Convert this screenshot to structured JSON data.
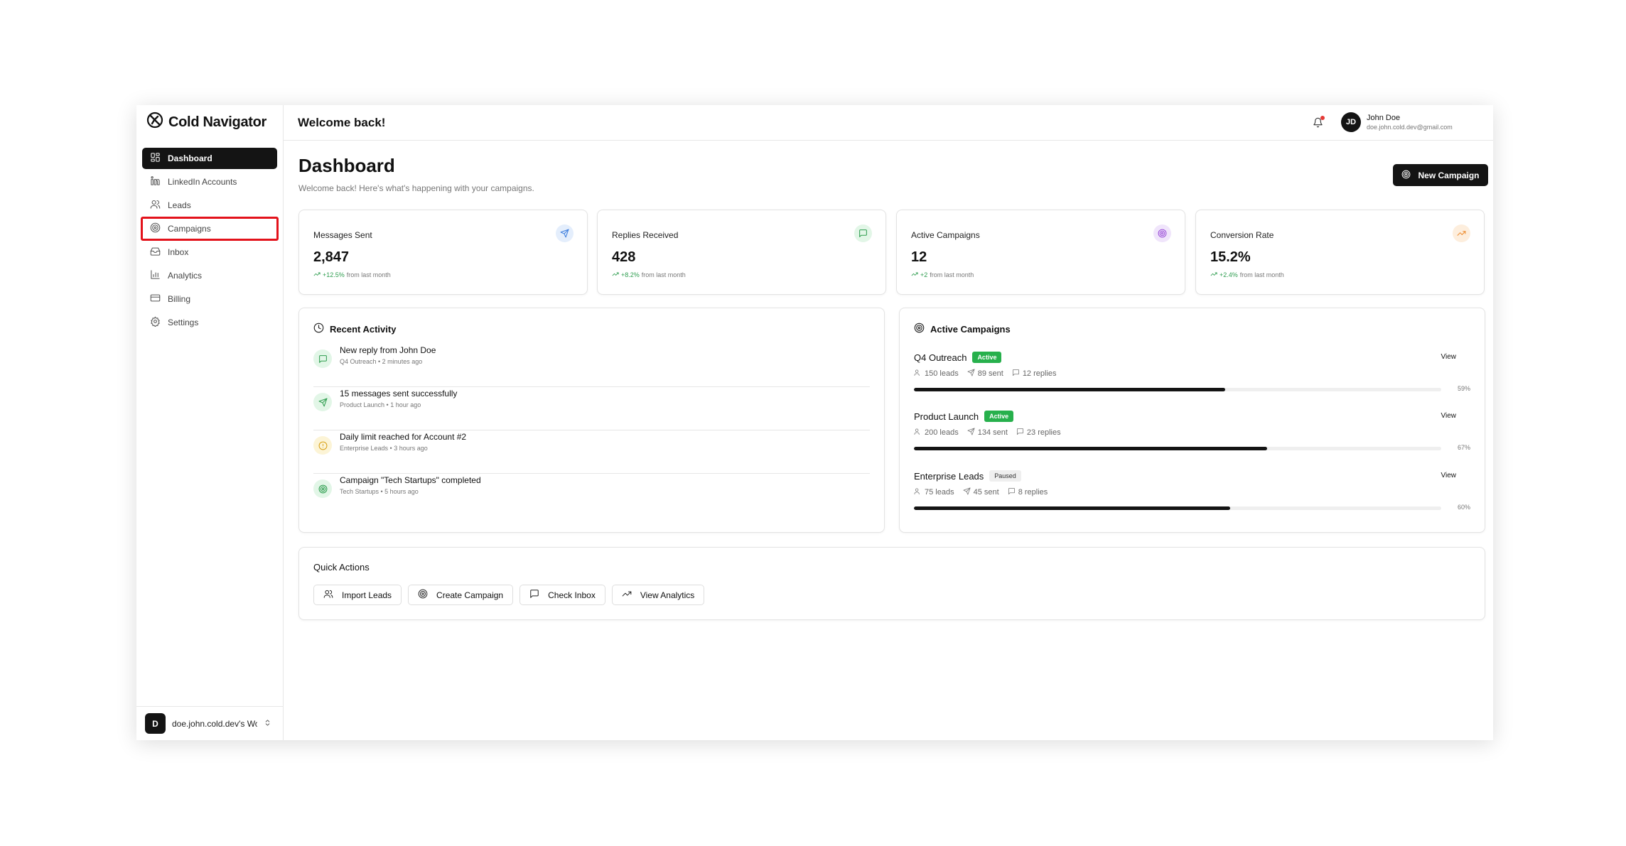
{
  "brand": {
    "name": "Cold Navigator"
  },
  "sidebar": {
    "items": [
      {
        "label": "Dashboard",
        "icon": "dashboard-grid-icon",
        "active": true
      },
      {
        "label": "LinkedIn Accounts",
        "icon": "linkedin-icon"
      },
      {
        "label": "Leads",
        "icon": "users-icon"
      },
      {
        "label": "Campaigns",
        "icon": "target-icon",
        "highlighted": true
      },
      {
        "label": "Inbox",
        "icon": "inbox-icon"
      },
      {
        "label": "Analytics",
        "icon": "bar-chart-icon"
      },
      {
        "label": "Billing",
        "icon": "credit-card-icon"
      },
      {
        "label": "Settings",
        "icon": "gear-icon"
      }
    ],
    "workspace": {
      "initial": "D",
      "name": "doe.john.cold.dev's Workspace"
    }
  },
  "header": {
    "title": "Welcome back!",
    "user": {
      "initials": "JD",
      "name": "John Doe",
      "email": "doe.john.cold.dev@gmail.com"
    }
  },
  "page": {
    "title": "Dashboard",
    "subtitle": "Welcome back! Here's what's happening with your campaigns.",
    "new_campaign_label": "New Campaign"
  },
  "stats": [
    {
      "label": "Messages Sent",
      "value": "2,847",
      "change": "+12.5%",
      "suffix": "from last month",
      "icon": "send-icon",
      "icon_color": "#3b7ddd",
      "icon_bg": "#e4eefc"
    },
    {
      "label": "Replies Received",
      "value": "428",
      "change": "+8.2%",
      "suffix": "from last month",
      "icon": "message-icon",
      "icon_color": "#2e9d4f",
      "icon_bg": "#e2f6e7"
    },
    {
      "label": "Active Campaigns",
      "value": "12",
      "change": "+2",
      "suffix": "from last month",
      "icon": "target-icon",
      "icon_color": "#9b4fd8",
      "icon_bg": "#f0e5fb"
    },
    {
      "label": "Conversion Rate",
      "value": "15.2%",
      "change": "+2.4%",
      "suffix": "from last month",
      "icon": "trending-up-icon",
      "icon_color": "#ec8a2c",
      "icon_bg": "#fdeedd"
    }
  ],
  "recent_activity": {
    "title": "Recent Activity",
    "items": [
      {
        "title": "New reply from John Doe",
        "meta": "Q4 Outreach • 2 minutes ago",
        "icon": "message-icon",
        "icon_color": "#2e9d4f",
        "icon_bg": "#e2f6e7"
      },
      {
        "title": "15 messages sent successfully",
        "meta": "Product Launch • 1 hour ago",
        "icon": "send-icon",
        "icon_color": "#2e9d4f",
        "icon_bg": "#e2f6e7"
      },
      {
        "title": "Daily limit reached for Account #2",
        "meta": "Enterprise Leads • 3 hours ago",
        "icon": "alert-circle-icon",
        "icon_color": "#d8a015",
        "icon_bg": "#fcf4d6"
      },
      {
        "title": "Campaign \"Tech Startups\" completed",
        "meta": "Tech Startups • 5 hours ago",
        "icon": "target-icon",
        "icon_color": "#2e9d4f",
        "icon_bg": "#e2f6e7"
      }
    ]
  },
  "active_campaigns": {
    "title": "Active Campaigns",
    "view_label": "View",
    "items": [
      {
        "name": "Q4 Outreach",
        "status": "Active",
        "leads": "150 leads",
        "sent": "89 sent",
        "replies": "12 replies",
        "progress": 59,
        "progress_label": "59%"
      },
      {
        "name": "Product Launch",
        "status": "Active",
        "leads": "200 leads",
        "sent": "134 sent",
        "replies": "23 replies",
        "progress": 67,
        "progress_label": "67%"
      },
      {
        "name": "Enterprise Leads",
        "status": "Paused",
        "leads": "75 leads",
        "sent": "45 sent",
        "replies": "8 replies",
        "progress": 60,
        "progress_label": "60%"
      }
    ]
  },
  "quick_actions": {
    "title": "Quick Actions",
    "items": [
      {
        "label": "Import Leads",
        "icon": "users-icon"
      },
      {
        "label": "Create Campaign",
        "icon": "target-icon"
      },
      {
        "label": "Check Inbox",
        "icon": "message-icon"
      },
      {
        "label": "View Analytics",
        "icon": "trending-up-icon"
      }
    ]
  }
}
